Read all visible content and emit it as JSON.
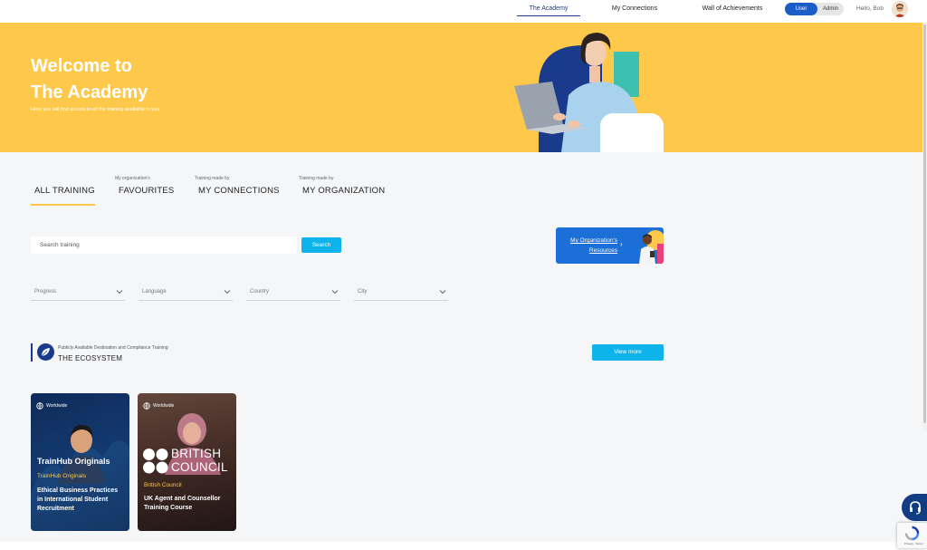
{
  "nav": {
    "tabs": [
      {
        "label": "The Academy",
        "active": true
      },
      {
        "label": "My Connections",
        "active": false
      },
      {
        "label": "Wall of Achievements",
        "active": false
      }
    ],
    "role_toggle": {
      "user": "User",
      "admin": "Admin",
      "selected": "User"
    },
    "greeting": "Hello, Bob"
  },
  "hero": {
    "title_line1": "Welcome to",
    "title_line2": "The Academy",
    "subtitle": "Here you will find access to all the training available to you"
  },
  "section_tabs": [
    {
      "pre": "",
      "label": "ALL TRAINING",
      "active": true
    },
    {
      "pre": "My organization's",
      "label": "FAVOURITES",
      "active": false
    },
    {
      "pre": "Training made by",
      "label": "MY CONNECTIONS",
      "active": false
    },
    {
      "pre": "Training made by",
      "label": "MY ORGANIZATION",
      "active": false
    }
  ],
  "search": {
    "placeholder": "Search training",
    "button": "Search"
  },
  "resources_card": {
    "line1": "My Organization's",
    "line2": "Resources"
  },
  "filters": [
    "Progress",
    "Language",
    "Country",
    "City"
  ],
  "ecosystem": {
    "pre": "Publicly Available Destination and Compliance Training",
    "title": "THE ECOSYSTEM",
    "view_more": "View more"
  },
  "courses": [
    {
      "badge": "Worldwide",
      "brand": "TrainHub Originals",
      "provider": "TrainHub Originals",
      "title": "Ethical Business Practices in International Student Recruitment"
    },
    {
      "badge": "Worldwide",
      "brand_line1": "BRITISH",
      "brand_line2": "COUNCIL",
      "provider": "British Council",
      "title": "UK Agent and Counsellor Training Course"
    }
  ],
  "recaptcha": "Privacy - Terms",
  "colors": {
    "hero_yellow": "#fec84a",
    "accent_blue": "#0db3ea",
    "navy": "#1a3a8c",
    "resources_blue": "#1b6fd6"
  }
}
